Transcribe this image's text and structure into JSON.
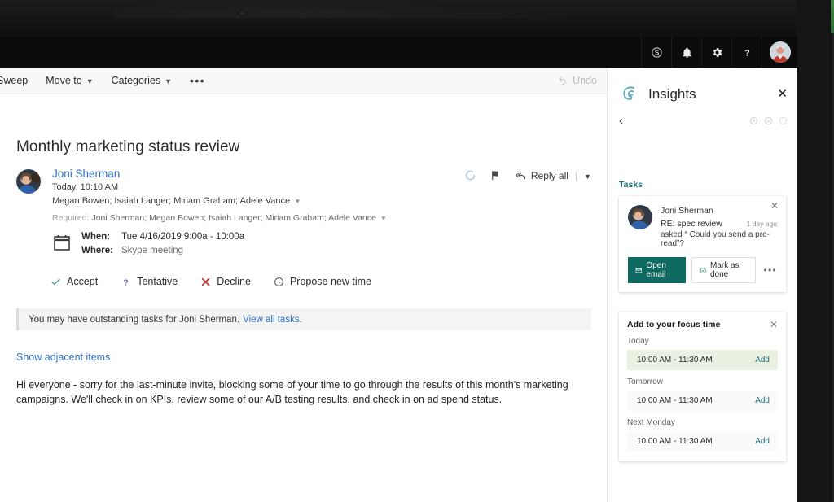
{
  "appbar": {
    "icons": [
      {
        "name": "skype-icon",
        "label": "Skype"
      },
      {
        "name": "notifications-bell-icon",
        "label": "Notifications"
      },
      {
        "name": "settings-gear-icon",
        "label": "Settings"
      },
      {
        "name": "help-question-icon",
        "label": "Help"
      }
    ],
    "account_avatar_label": "Account manager"
  },
  "command_bar": {
    "items": [
      {
        "label": "Sweep",
        "caret": false
      },
      {
        "label": "Move to",
        "caret": true
      },
      {
        "label": "Categories",
        "caret": true
      }
    ],
    "overflow_label": "•••",
    "undo_label": "Undo"
  },
  "message": {
    "subject": "Monthly marketing status review",
    "sender": "Joni Sherman",
    "timestamp": "Today, 10:10 AM",
    "recipients": "Megan Bowen; Isaiah Langer; Miriam Graham; Adele Vance",
    "required_label": "Required:",
    "required_names": "Joni Sherman; Megan Bowen; Isaiah Langer; Miriam Graham; Adele Vance",
    "when_label": "When:",
    "when_value": "Tue 4/16/2019 9:00a - 10:00a",
    "where_label": "Where:",
    "where_value": "Skype meeting",
    "reply_all_label": "Reply all",
    "rsvp": [
      {
        "label": "Accept",
        "icon": "check-icon",
        "color": "#4f9a94"
      },
      {
        "label": "Tentative",
        "icon": "question-icon",
        "color": "#7a5fb5"
      },
      {
        "label": "Decline",
        "icon": "x-icon",
        "color": "#c4281b"
      },
      {
        "label": "Propose new time",
        "icon": "clock-icon",
        "color": "#4a4a4a"
      }
    ],
    "banner_text": "You may have outstanding tasks for Joni Sherman.",
    "banner_link": "View all tasks.",
    "show_adjacent_label": "Show adjacent items",
    "body_paragraph": "Hi everyone - sorry for the last-minute invite, blocking some of your time to go through the results of this month's marketing campaigns. We'll check in on KPIs, review some of our A/B testing results, and check in on ad spend status."
  },
  "insights": {
    "title": "Insights",
    "close_label": "✕",
    "back_label": "‹",
    "section_tasks_label": "Tasks",
    "task_card": {
      "close_label": "✕",
      "person": "Joni Sherman",
      "subject": "RE: spec review",
      "age": "1 day ago",
      "quote": "asked “ Could you send a pre-read”?",
      "open_email_label": "Open email",
      "mark_done_label": "Mark as done",
      "more_label": "•••",
      "primary_color": "#0f6a62"
    },
    "focus_card": {
      "title": "Add to your focus time",
      "close_label": "✕",
      "add_label": "Add",
      "groups": [
        {
          "day": "Today",
          "slot": "10:00 AM - 11:30 AM",
          "highlighted": true
        },
        {
          "day": "Tomorrow",
          "slot": "10:00 AM - 11:30 AM",
          "highlighted": false
        },
        {
          "day": "Next Monday",
          "slot": "10:00 AM - 11:30 AM",
          "highlighted": false
        }
      ]
    }
  }
}
